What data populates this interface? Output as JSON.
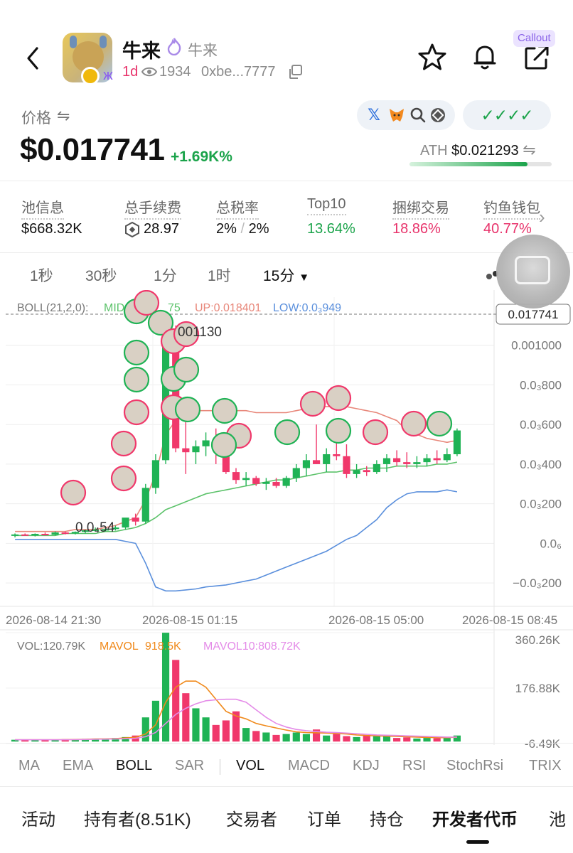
{
  "header": {
    "name": "牛来",
    "subname": "牛来",
    "age": "1d",
    "views": "1934",
    "address": "0xbe...7777",
    "callout_label": "Callout"
  },
  "price": {
    "label": "价格",
    "swap_icon": "⇋",
    "value": "$0.017741",
    "change": "+1.69K%",
    "checks": "✓✓✓✓",
    "ath_label": "ATH",
    "ath_value": "$0.021293",
    "ath_progress": 0.83
  },
  "stats": [
    {
      "label": "池信息",
      "value": "$668.32K",
      "color": "#111"
    },
    {
      "label": "总手续费",
      "value": "28.97",
      "color": "#111"
    },
    {
      "label": "总税率",
      "value": "2%",
      "value2": "2%",
      "color": "#111"
    },
    {
      "label": "Top10",
      "value": "13.64%",
      "color": "#1aa34a"
    },
    {
      "label": "捆绑交易",
      "value": "18.86%",
      "color": "#e8336b"
    },
    {
      "label": "钓鱼钱包",
      "value": "40.77%",
      "color": "#e8336b"
    }
  ],
  "intervals": [
    "1秒",
    "30秒",
    "1分",
    "1时",
    "15分"
  ],
  "active_interval": "15分",
  "colors": {
    "up": "#1fb355",
    "down": "#f0386b",
    "mid": "#5cc26a",
    "upper": "#e8877a",
    "lower": "#5a8fdc"
  },
  "chart_data": {
    "type": "candlestick",
    "boll_label": "BOLL(21,2,0):",
    "mid_label": "MID",
    "mid_value": "75",
    "up_label": "UP:0.018401",
    "low_label": "LOW:0.0₃949",
    "current_price_label": "0.017741",
    "y_ticks": [
      "0.001000",
      "0.0₃800",
      "0.0₃600",
      "0.0₃400",
      "0.0₃200",
      "0.0₆",
      "−0.0₃200"
    ],
    "x_ticks": [
      "2026-08-14 21:30",
      "2026-08-15 01:15",
      "2026-08-15 05:00",
      "2026-08-15 08:45"
    ],
    "annotations": [
      "001130",
      "0.0₄54"
    ],
    "ylim": [
      -0.0003,
      0.0012
    ],
    "candles": [
      {
        "o": 4e-05,
        "h": 5e-05,
        "l": 3e-05,
        "c": 4.5e-05
      },
      {
        "o": 4.5e-05,
        "h": 5e-05,
        "l": 4e-05,
        "c": 4e-05
      },
      {
        "o": 4e-05,
        "h": 5e-05,
        "l": 3.5e-05,
        "c": 4.8e-05
      },
      {
        "o": 4.8e-05,
        "h": 5.5e-05,
        "l": 4e-05,
        "c": 4.4e-05
      },
      {
        "o": 4.4e-05,
        "h": 6e-05,
        "l": 4e-05,
        "c": 5.5e-05
      },
      {
        "o": 5.5e-05,
        "h": 6e-05,
        "l": 4.5e-05,
        "c": 5e-05
      },
      {
        "o": 5e-05,
        "h": 6e-05,
        "l": 4.5e-05,
        "c": 5.8e-05
      },
      {
        "o": 5.8e-05,
        "h": 7e-05,
        "l": 5e-05,
        "c": 6.6e-05
      },
      {
        "o": 6.6e-05,
        "h": 8e-05,
        "l": 6e-05,
        "c": 7e-05
      },
      {
        "o": 7e-05,
        "h": 8e-05,
        "l": 6e-05,
        "c": 7.2e-05
      },
      {
        "o": 7.2e-05,
        "h": 9e-05,
        "l": 6.5e-05,
        "c": 8e-05
      },
      {
        "o": 8e-05,
        "h": 0.00012,
        "l": 7e-05,
        "c": 0.00013
      },
      {
        "o": 0.00013,
        "h": 0.00015,
        "l": 9e-05,
        "c": 0.00011
      },
      {
        "o": 0.00011,
        "h": 0.0003,
        "l": 0.0001,
        "c": 0.00028
      },
      {
        "o": 0.00028,
        "h": 0.00045,
        "l": 0.00025,
        "c": 0.00042
      },
      {
        "o": 0.00042,
        "h": 0.0011,
        "l": 0.0004,
        "c": 0.00105
      },
      {
        "o": 0.00105,
        "h": 0.0011,
        "l": 0.00046,
        "c": 0.00048
      },
      {
        "o": 0.00048,
        "h": 0.00068,
        "l": 0.00035,
        "c": 0.00046
      },
      {
        "o": 0.00046,
        "h": 0.00052,
        "l": 0.0004,
        "c": 0.00049
      },
      {
        "o": 0.00049,
        "h": 0.00056,
        "l": 0.00044,
        "c": 0.00052
      },
      {
        "o": 0.00052,
        "h": 0.00058,
        "l": 0.0004,
        "c": 0.00047
      },
      {
        "o": 0.00047,
        "h": 0.00054,
        "l": 0.00035,
        "c": 0.00036
      },
      {
        "o": 0.00036,
        "h": 0.00038,
        "l": 0.0003,
        "c": 0.00032
      },
      {
        "o": 0.00032,
        "h": 0.00036,
        "l": 0.00029,
        "c": 0.00033
      },
      {
        "o": 0.00033,
        "h": 0.00034,
        "l": 0.00029,
        "c": 0.0003
      },
      {
        "o": 0.0003,
        "h": 0.00033,
        "l": 0.00027,
        "c": 0.00031
      },
      {
        "o": 0.00031,
        "h": 0.00033,
        "l": 0.00028,
        "c": 0.00029
      },
      {
        "o": 0.00029,
        "h": 0.00034,
        "l": 0.00028,
        "c": 0.00033
      },
      {
        "o": 0.00033,
        "h": 0.0004,
        "l": 0.00031,
        "c": 0.00038
      },
      {
        "o": 0.00038,
        "h": 0.00045,
        "l": 0.00034,
        "c": 0.00042
      },
      {
        "o": 0.00042,
        "h": 0.0006,
        "l": 0.0004,
        "c": 0.0004
      },
      {
        "o": 0.0004,
        "h": 0.00048,
        "l": 0.00036,
        "c": 0.00045
      },
      {
        "o": 0.00045,
        "h": 0.00056,
        "l": 0.00042,
        "c": 0.00044
      },
      {
        "o": 0.00044,
        "h": 0.0005,
        "l": 0.00033,
        "c": 0.00035
      },
      {
        "o": 0.00035,
        "h": 0.0004,
        "l": 0.00033,
        "c": 0.00037
      },
      {
        "o": 0.00037,
        "h": 0.00039,
        "l": 0.00034,
        "c": 0.00036
      },
      {
        "o": 0.00036,
        "h": 0.00042,
        "l": 0.00035,
        "c": 0.0004
      },
      {
        "o": 0.0004,
        "h": 0.00045,
        "l": 0.00036,
        "c": 0.00043
      },
      {
        "o": 0.00043,
        "h": 0.00047,
        "l": 0.00039,
        "c": 0.00041
      },
      {
        "o": 0.00041,
        "h": 0.00046,
        "l": 0.00038,
        "c": 0.0004
      },
      {
        "o": 0.0004,
        "h": 0.00044,
        "l": 0.00038,
        "c": 0.00041
      },
      {
        "o": 0.00041,
        "h": 0.00045,
        "l": 0.00039,
        "c": 0.00043
      },
      {
        "o": 0.00043,
        "h": 0.00047,
        "l": 0.0004,
        "c": 0.00042
      },
      {
        "o": 0.00042,
        "h": 0.00048,
        "l": 0.00041,
        "c": 0.00045
      },
      {
        "o": 0.00045,
        "h": 0.00058,
        "l": 0.00044,
        "c": 0.00057
      }
    ],
    "volume": {
      "vol_label": "VOL:120.79K",
      "mavol5_label": "MAVOL",
      "mavol5_value": "918.5K",
      "mavol10_label": "MAVOL10:808.72K",
      "y_ticks": [
        "360.26K",
        "176.88K",
        "-6.49K"
      ],
      "ylim": [
        -6490,
        360260
      ],
      "values": [
        6000,
        5000,
        7000,
        5000,
        6000,
        8000,
        7000,
        9000,
        10000,
        9000,
        12000,
        15000,
        20000,
        80000,
        135000,
        360000,
        270000,
        160000,
        110000,
        80000,
        55000,
        70000,
        100000,
        45000,
        35000,
        30000,
        22000,
        25000,
        30000,
        25000,
        40000,
        20000,
        25000,
        18000,
        15000,
        22000,
        18000,
        20000,
        12000,
        14000,
        10000,
        12000,
        11000,
        12000,
        20000
      ],
      "mavol5": [
        6000,
        6000,
        6000,
        6000,
        6000,
        6500,
        7000,
        7500,
        8500,
        9000,
        10000,
        12000,
        14000,
        25000,
        55000,
        130000,
        180000,
        200000,
        200000,
        180000,
        140000,
        100000,
        85000,
        75000,
        60000,
        52000,
        45000,
        38000,
        32000,
        30000,
        29000,
        28000,
        27000,
        25000,
        22000,
        20000,
        19000,
        18000,
        17000,
        16000,
        15000,
        14000,
        13000,
        13000,
        15000
      ],
      "mavol10": [
        6000,
        6000,
        6000,
        6000,
        6000,
        6000,
        6500,
        7000,
        7500,
        8000,
        8500,
        9500,
        11000,
        16000,
        30000,
        60000,
        90000,
        110000,
        125000,
        135000,
        138000,
        140000,
        140000,
        130000,
        105000,
        80000,
        60000,
        48000,
        40000,
        36000,
        33000,
        31000,
        30000,
        28000,
        26000,
        24000,
        22000,
        21000,
        20000,
        19000,
        18000,
        17000,
        16000,
        15000,
        15000
      ]
    },
    "boll": {
      "upper": [
        6e-05,
        6e-05,
        6e-05,
        6e-05,
        6e-05,
        6e-05,
        7e-05,
        7e-05,
        7e-05,
        8e-05,
        9e-05,
        0.00011,
        0.00013,
        0.00022,
        0.00035,
        0.00055,
        0.00062,
        0.00066,
        0.00067,
        0.00067,
        0.00067,
        0.00067,
        0.00067,
        0.00067,
        0.00066,
        0.00066,
        0.00066,
        0.00066,
        0.00067,
        0.00068,
        0.00069,
        0.00069,
        0.00069,
        0.00069,
        0.00068,
        0.00067,
        0.00066,
        0.00064,
        0.00062,
        0.00057,
        0.00055,
        0.00053,
        0.00052,
        0.00051,
        0.00052
      ],
      "mid": [
        4e-05,
        4e-05,
        4e-05,
        4e-05,
        4e-05,
        5e-05,
        5e-05,
        5e-05,
        5e-05,
        6e-05,
        6e-05,
        7e-05,
        8e-05,
        0.0001,
        0.00013,
        0.00017,
        0.00019,
        0.00021,
        0.00023,
        0.00025,
        0.00026,
        0.00027,
        0.00028,
        0.00029,
        0.0003,
        0.00031,
        0.00032,
        0.00032,
        0.00033,
        0.00034,
        0.00035,
        0.00036,
        0.00036,
        0.00037,
        0.00037,
        0.00038,
        0.00038,
        0.00038,
        0.00039,
        0.00039,
        0.00039,
        0.00039,
        0.0004,
        0.0004,
        0.00041
      ],
      "lower": [
        2e-05,
        2e-05,
        2e-05,
        2e-05,
        2e-05,
        2e-05,
        2e-05,
        2e-05,
        2e-05,
        2e-05,
        2e-05,
        1e-05,
        0.0,
        -0.0001,
        -0.00022,
        -0.00024,
        -0.00024,
        -0.000235,
        -0.00023,
        -0.00022,
        -0.000215,
        -0.00021,
        -0.0002,
        -0.00019,
        -0.00018,
        -0.00016,
        -0.00014,
        -0.00012,
        -0.0001,
        -8e-05,
        -6e-05,
        -4e-05,
        -1e-05,
        2e-05,
        4e-05,
        8e-05,
        0.00012,
        0.00018,
        0.00022,
        0.00025,
        0.00026,
        0.00026,
        0.00026,
        0.00027,
        0.00026
      ]
    }
  },
  "indicators": [
    "MA",
    "EMA",
    "BOLL",
    "SAR",
    "VOL",
    "MACD",
    "KDJ",
    "RSI",
    "StochRsi",
    "TRIX"
  ],
  "active_indicators": [
    "BOLL",
    "VOL"
  ],
  "bottom_tabs": [
    "活动",
    "持有者(8.51K)",
    "交易者",
    "订单",
    "持仓",
    "开发者代币",
    "池"
  ],
  "active_bottom_tab": "开发者代币"
}
